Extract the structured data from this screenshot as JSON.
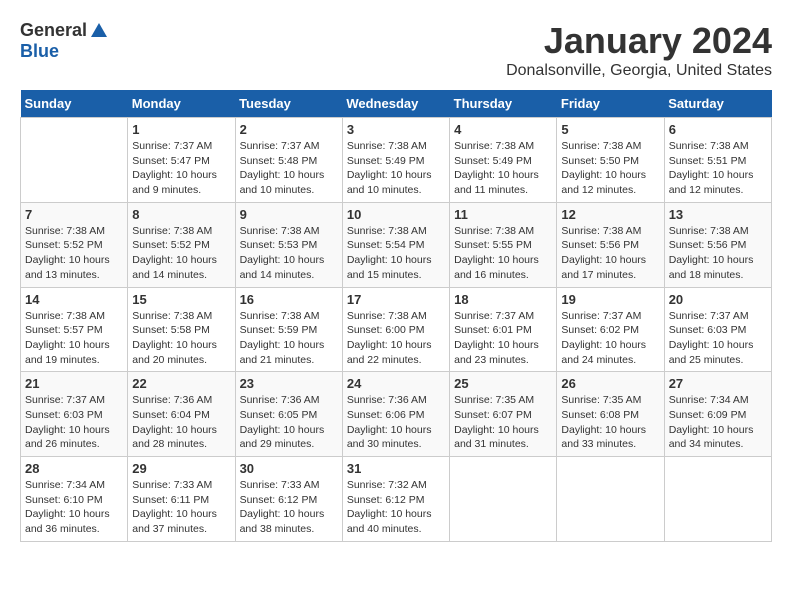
{
  "header": {
    "logo_general": "General",
    "logo_blue": "Blue",
    "title": "January 2024",
    "subtitle": "Donalsonville, Georgia, United States"
  },
  "days_of_week": [
    "Sunday",
    "Monday",
    "Tuesday",
    "Wednesday",
    "Thursday",
    "Friday",
    "Saturday"
  ],
  "weeks": [
    [
      {
        "day": "",
        "info": ""
      },
      {
        "day": "1",
        "info": "Sunrise: 7:37 AM\nSunset: 5:47 PM\nDaylight: 10 hours\nand 9 minutes."
      },
      {
        "day": "2",
        "info": "Sunrise: 7:37 AM\nSunset: 5:48 PM\nDaylight: 10 hours\nand 10 minutes."
      },
      {
        "day": "3",
        "info": "Sunrise: 7:38 AM\nSunset: 5:49 PM\nDaylight: 10 hours\nand 10 minutes."
      },
      {
        "day": "4",
        "info": "Sunrise: 7:38 AM\nSunset: 5:49 PM\nDaylight: 10 hours\nand 11 minutes."
      },
      {
        "day": "5",
        "info": "Sunrise: 7:38 AM\nSunset: 5:50 PM\nDaylight: 10 hours\nand 12 minutes."
      },
      {
        "day": "6",
        "info": "Sunrise: 7:38 AM\nSunset: 5:51 PM\nDaylight: 10 hours\nand 12 minutes."
      }
    ],
    [
      {
        "day": "7",
        "info": "Sunrise: 7:38 AM\nSunset: 5:52 PM\nDaylight: 10 hours\nand 13 minutes."
      },
      {
        "day": "8",
        "info": "Sunrise: 7:38 AM\nSunset: 5:52 PM\nDaylight: 10 hours\nand 14 minutes."
      },
      {
        "day": "9",
        "info": "Sunrise: 7:38 AM\nSunset: 5:53 PM\nDaylight: 10 hours\nand 14 minutes."
      },
      {
        "day": "10",
        "info": "Sunrise: 7:38 AM\nSunset: 5:54 PM\nDaylight: 10 hours\nand 15 minutes."
      },
      {
        "day": "11",
        "info": "Sunrise: 7:38 AM\nSunset: 5:55 PM\nDaylight: 10 hours\nand 16 minutes."
      },
      {
        "day": "12",
        "info": "Sunrise: 7:38 AM\nSunset: 5:56 PM\nDaylight: 10 hours\nand 17 minutes."
      },
      {
        "day": "13",
        "info": "Sunrise: 7:38 AM\nSunset: 5:56 PM\nDaylight: 10 hours\nand 18 minutes."
      }
    ],
    [
      {
        "day": "14",
        "info": "Sunrise: 7:38 AM\nSunset: 5:57 PM\nDaylight: 10 hours\nand 19 minutes."
      },
      {
        "day": "15",
        "info": "Sunrise: 7:38 AM\nSunset: 5:58 PM\nDaylight: 10 hours\nand 20 minutes."
      },
      {
        "day": "16",
        "info": "Sunrise: 7:38 AM\nSunset: 5:59 PM\nDaylight: 10 hours\nand 21 minutes."
      },
      {
        "day": "17",
        "info": "Sunrise: 7:38 AM\nSunset: 6:00 PM\nDaylight: 10 hours\nand 22 minutes."
      },
      {
        "day": "18",
        "info": "Sunrise: 7:37 AM\nSunset: 6:01 PM\nDaylight: 10 hours\nand 23 minutes."
      },
      {
        "day": "19",
        "info": "Sunrise: 7:37 AM\nSunset: 6:02 PM\nDaylight: 10 hours\nand 24 minutes."
      },
      {
        "day": "20",
        "info": "Sunrise: 7:37 AM\nSunset: 6:03 PM\nDaylight: 10 hours\nand 25 minutes."
      }
    ],
    [
      {
        "day": "21",
        "info": "Sunrise: 7:37 AM\nSunset: 6:03 PM\nDaylight: 10 hours\nand 26 minutes."
      },
      {
        "day": "22",
        "info": "Sunrise: 7:36 AM\nSunset: 6:04 PM\nDaylight: 10 hours\nand 28 minutes."
      },
      {
        "day": "23",
        "info": "Sunrise: 7:36 AM\nSunset: 6:05 PM\nDaylight: 10 hours\nand 29 minutes."
      },
      {
        "day": "24",
        "info": "Sunrise: 7:36 AM\nSunset: 6:06 PM\nDaylight: 10 hours\nand 30 minutes."
      },
      {
        "day": "25",
        "info": "Sunrise: 7:35 AM\nSunset: 6:07 PM\nDaylight: 10 hours\nand 31 minutes."
      },
      {
        "day": "26",
        "info": "Sunrise: 7:35 AM\nSunset: 6:08 PM\nDaylight: 10 hours\nand 33 minutes."
      },
      {
        "day": "27",
        "info": "Sunrise: 7:34 AM\nSunset: 6:09 PM\nDaylight: 10 hours\nand 34 minutes."
      }
    ],
    [
      {
        "day": "28",
        "info": "Sunrise: 7:34 AM\nSunset: 6:10 PM\nDaylight: 10 hours\nand 36 minutes."
      },
      {
        "day": "29",
        "info": "Sunrise: 7:33 AM\nSunset: 6:11 PM\nDaylight: 10 hours\nand 37 minutes."
      },
      {
        "day": "30",
        "info": "Sunrise: 7:33 AM\nSunset: 6:12 PM\nDaylight: 10 hours\nand 38 minutes."
      },
      {
        "day": "31",
        "info": "Sunrise: 7:32 AM\nSunset: 6:12 PM\nDaylight: 10 hours\nand 40 minutes."
      },
      {
        "day": "",
        "info": ""
      },
      {
        "day": "",
        "info": ""
      },
      {
        "day": "",
        "info": ""
      }
    ]
  ]
}
